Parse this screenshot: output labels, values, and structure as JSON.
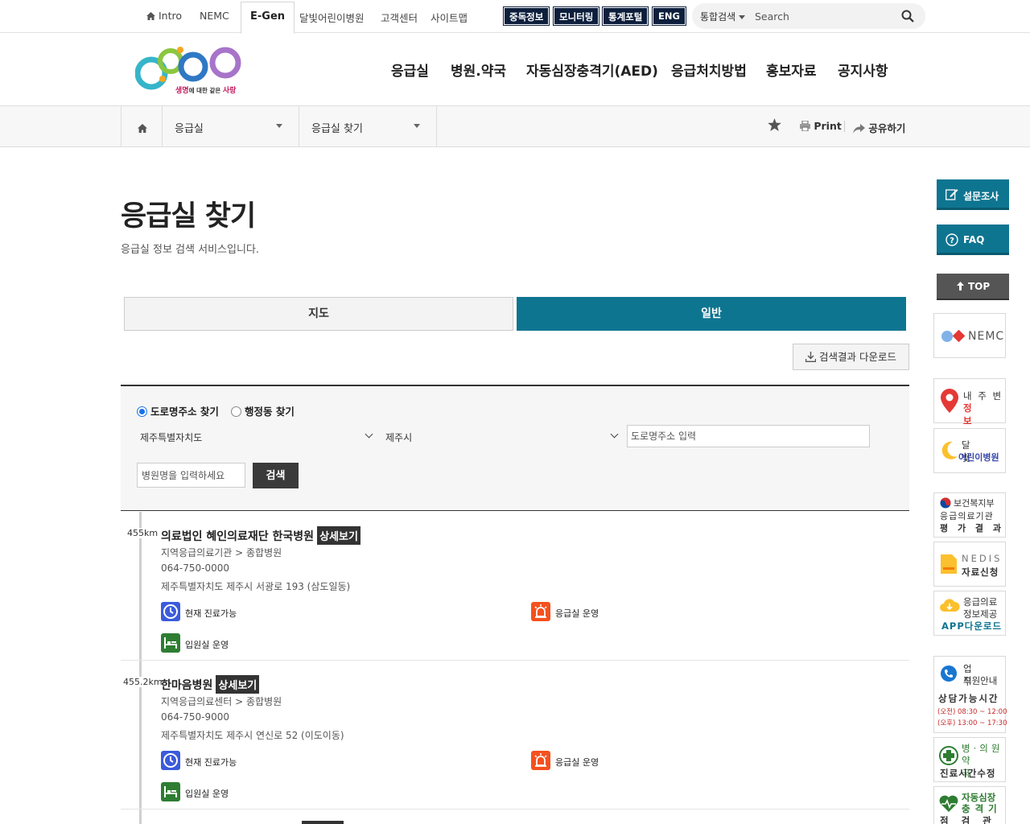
{
  "topbar": {
    "links": [
      "Intro",
      "NEMC",
      "E-Gen",
      "달빛어린이병원",
      "고객센터",
      "사이트맵"
    ],
    "dark_buttons": [
      "중독정보",
      "모니터링",
      "통계포털",
      "ENG"
    ],
    "search_scope": "통합검색",
    "search_placeholder": "Search"
  },
  "logo": {
    "tagline_a": "생명",
    "tagline_b": "에 대한 같은 ",
    "tagline_c": "사랑"
  },
  "gnb": [
    "응급실",
    "병원.약국",
    "자동심장충격기(AED)",
    "응급처치방법",
    "홍보자료",
    "공지사항"
  ],
  "location": {
    "level1": "응급실",
    "level2": "응급실 찾기",
    "print": "Print",
    "share": "공유하기"
  },
  "page": {
    "title": "응급실 찾기",
    "description": "응급실 정보 검색 서비스입니다."
  },
  "tabs": {
    "map": "지도",
    "general": "일반"
  },
  "download_label": "검색결과 다운로드",
  "search": {
    "radio_road": "도로명주소 찾기",
    "radio_admin": "행정동 찾기",
    "province": "제주특별자치도",
    "city": "제주시",
    "address_placeholder": "도로명주소 입력",
    "hospital_placeholder": "병원명을 입력하세요",
    "button": "검색"
  },
  "results": [
    {
      "distance": "455km",
      "name": "의료법인 혜인의료재단 한국병원",
      "detail": "상세보기",
      "category": "지역응급의료기관 > 종합병원",
      "phone": "064-750-0000",
      "address": "제주특별자치도 제주시 서광로 193 (삼도일동)",
      "status_now": "현재 진료가능",
      "status_er": "응급실 운영",
      "status_ward": "입원실 운영"
    },
    {
      "distance": "455.2km",
      "name": "한마음병원",
      "detail": "상세보기",
      "category": "지역응급의료센터 > 종합병원",
      "phone": "064-750-9000",
      "address": "제주특별자치도 제주시 연신로 52 (이도이동)",
      "status_now": "현재 진료가능",
      "status_er": "응급실 운영",
      "status_ward": "입원실 운영"
    }
  ],
  "quick": {
    "survey": "설문조사",
    "faq": "FAQ",
    "top": "TOP",
    "nemc": "NEMC",
    "b1_l1": "내 주 변",
    "b1_l2": "정 보",
    "b2_l1": "달 빛",
    "b2_l2": "어린이병원",
    "b3_l1": "보건복지부",
    "b3_l2": "응급의료기관",
    "b3_l3": "평 가 결 과",
    "b4_l1": "NEDIS",
    "b4_l2": "자료신청",
    "b5_l1": "응급의료",
    "b5_l2": "정보제공",
    "b5_l3": "APP다운로드",
    "b6_l1": "업 무",
    "b6_l2": "직원안내",
    "b6_l3": "상담가능시간",
    "b6_l4": "(오전) 08:30 ~ 12:00",
    "b6_l5": "(오후) 13:00 ~ 17:30",
    "b7_l1": "병·의원",
    "b7_l2": "약 국",
    "b7_l3": "진료시간수정",
    "b8_l1": "자동심장",
    "b8_l2": "충격기",
    "b8_l3": "점검관리"
  },
  "colors": {
    "accent": "#0e7591",
    "dark_nav": "#0d1f3c",
    "status_blue": "#3b5bdb",
    "status_orange": "#f4511e",
    "status_green": "#2e7d32"
  }
}
